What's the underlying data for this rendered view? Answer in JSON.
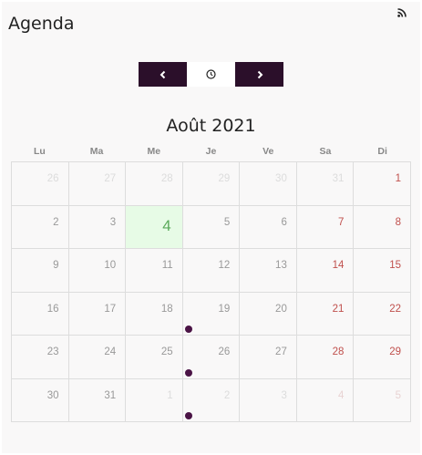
{
  "header": {
    "title": "Agenda",
    "rss_icon": "rss-icon"
  },
  "nav": {
    "prev_icon": "chevron-left-icon",
    "today_icon": "clock-icon",
    "next_icon": "chevron-right-icon"
  },
  "calendar": {
    "month_title": "Août 2021",
    "weekdays": [
      "Lu",
      "Ma",
      "Me",
      "Je",
      "Ve",
      "Sa",
      "Di"
    ],
    "weeks": [
      [
        "26",
        "27",
        "28",
        "29",
        "30",
        "31",
        "1"
      ],
      [
        "2",
        "3",
        "4",
        "5",
        "6",
        "7",
        "8"
      ],
      [
        "9",
        "10",
        "11",
        "12",
        "13",
        "14",
        "15"
      ],
      [
        "16",
        "17",
        "18",
        "19",
        "20",
        "21",
        "22"
      ],
      [
        "23",
        "24",
        "25",
        "26",
        "27",
        "28",
        "29"
      ],
      [
        "30",
        "31",
        "1",
        "2",
        "3",
        "4",
        "5"
      ]
    ],
    "today": "4",
    "event_days": [
      "18",
      "25",
      "1"
    ]
  },
  "colors": {
    "nav_button": "#2b0f2a",
    "today_background": "#e7fbe6",
    "today_text": "#5aaa5a",
    "weekend_text": "#c0504d",
    "event_dot": "#4a1345"
  }
}
